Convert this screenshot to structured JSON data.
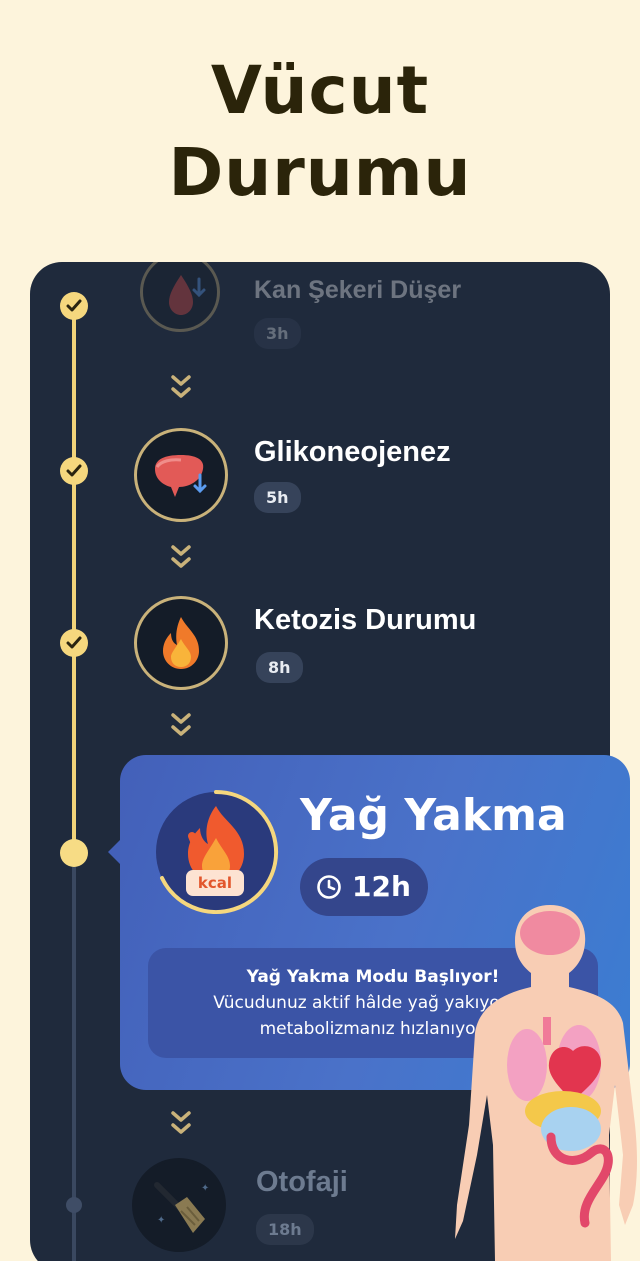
{
  "headline": {
    "line1": "Vücut",
    "line2": "Durumu"
  },
  "stages": [
    {
      "title": "Kan Şekeri Düşer",
      "time": "3h",
      "status": "done",
      "icon": "blood-drop-down-icon"
    },
    {
      "title": "Glikoneojenez",
      "time": "5h",
      "status": "done",
      "icon": "liver-down-icon"
    },
    {
      "title": "Ketozis Durumu",
      "time": "8h",
      "status": "done",
      "icon": "fire-icon"
    },
    {
      "title": "Yağ Yakma",
      "time": "12h",
      "status": "current",
      "icon": "fire-kcal-icon",
      "badge": "kcal",
      "info_title": "Yağ Yakma Modu Başlıyor!",
      "info_line1": "Vücudunuz aktif hâlde yağ yakıyor ve",
      "info_line2": "metabolizmanız hızlanıyor."
    },
    {
      "title": "Otofaji",
      "time": "18h",
      "status": "upcoming",
      "icon": "broom-icon"
    }
  ],
  "colors": {
    "background": "#fdf4dc",
    "card": "#1f2a3c",
    "accent": "#f1d37a",
    "active": "#4a72c9"
  }
}
